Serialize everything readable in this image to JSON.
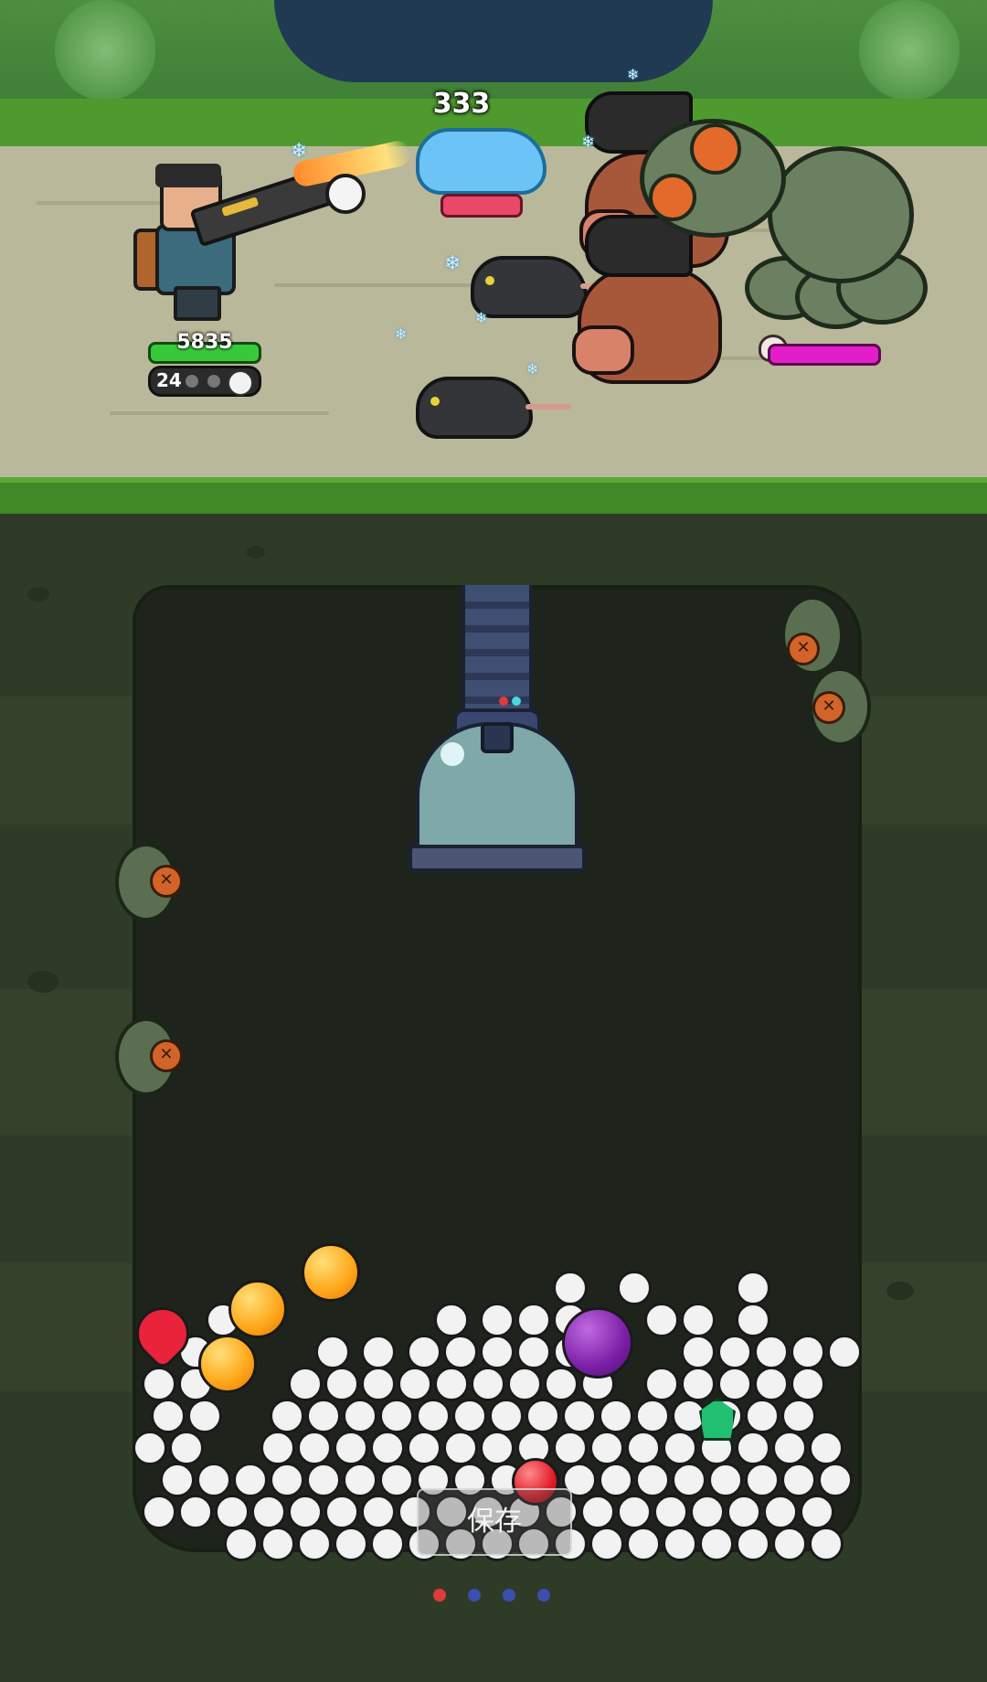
{
  "hud": {
    "hero_hp": "5835",
    "ammo_count": "24",
    "damage_popup": "333"
  },
  "colors": {
    "hero_hp_bar": "#38c93a",
    "enemy_hp_bar": "#e8486a",
    "boss_hp_bar": "#e21ec9",
    "page_dot_active": "#e03a3a",
    "page_dot_inactive": "#3a4fb0"
  },
  "icons": [
    "skull-icon",
    "snowflake-icon",
    "bullet-icon"
  ],
  "controls": {
    "save_label": "保存"
  },
  "pagination": {
    "total": 4,
    "active_index": 0
  }
}
